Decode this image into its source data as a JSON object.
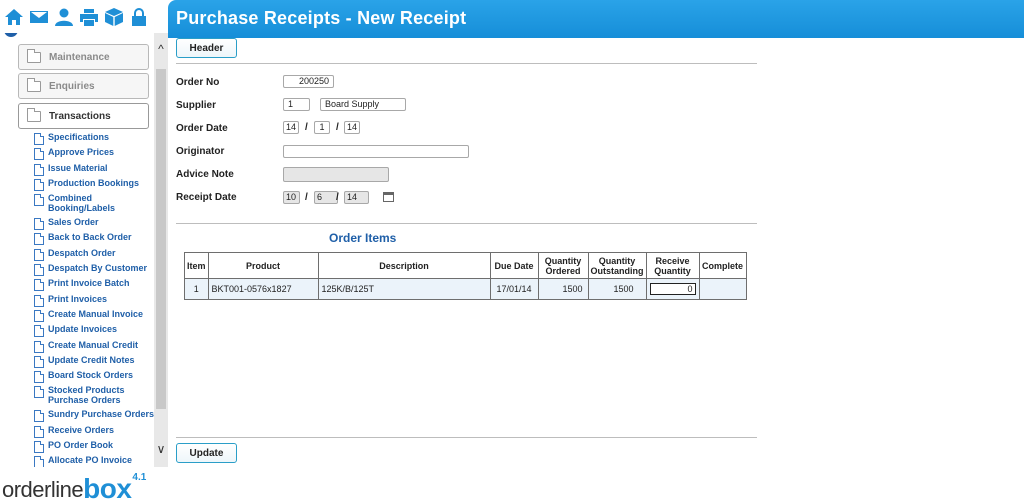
{
  "title": "Purchase Receipts - New Receipt",
  "toolbar_icons": [
    "home-icon",
    "mail-icon",
    "user-icon",
    "print-icon",
    "box-icon",
    "lock-icon"
  ],
  "sidebar": {
    "folders": [
      {
        "label": "Maintenance",
        "active": false
      },
      {
        "label": "Enquiries",
        "active": false
      },
      {
        "label": "Transactions",
        "active": true
      }
    ],
    "items": [
      "Specifications",
      "Approve Prices",
      "Issue Material",
      "Production Bookings",
      "Combined Booking/Labels",
      "Sales Order",
      "Back to Back Order",
      "Despatch Order",
      "Despatch By Customer",
      "Print Invoice Batch",
      "Print Invoices",
      "Create Manual Invoice",
      "Update Invoices",
      "Create Manual Credit",
      "Update Credit Notes",
      "Board Stock Orders",
      "Stocked Products Purchase Orders",
      "Sundry Purchase Orders",
      "Receive Orders",
      "PO Order Book",
      "Allocate PO Invoice"
    ]
  },
  "logo": {
    "text": "orderline",
    "brand": "box",
    "version": "4.1"
  },
  "buttons": {
    "header": "Header",
    "update": "Update"
  },
  "form": {
    "order_no_label": "Order No",
    "order_no": "200250",
    "supplier_label": "Supplier",
    "supplier_code": "1",
    "supplier_name": "Board Supply",
    "order_date_label": "Order Date",
    "order_date_d": "14",
    "order_date_m": "1",
    "order_date_y": "14",
    "originator_label": "Originator",
    "originator": "",
    "advice_note_label": "Advice Note",
    "advice_note": "",
    "receipt_date_label": "Receipt Date",
    "receipt_date_d": "10",
    "receipt_date_m": "6",
    "receipt_date_y": "14",
    "slash": "/"
  },
  "order_items": {
    "title": "Order Items",
    "columns": [
      "Item",
      "Product",
      "Description",
      "Due Date",
      "Quantity Ordered",
      "Quantity Outstanding",
      "Receive Quantity",
      "Complete"
    ],
    "rows": [
      {
        "item": "1",
        "product": "BKT001-0576x1827",
        "description": "125K/B/125T",
        "due_date": "17/01/14",
        "qty_ordered": "1500",
        "qty_outstanding": "1500",
        "receive_qty": "0",
        "complete": ""
      }
    ]
  },
  "colors": {
    "accent": "#1f8fd6",
    "link": "#1f5fa8",
    "header_bg": "#2aa3e8",
    "row_bg": "#ebf3fa"
  }
}
